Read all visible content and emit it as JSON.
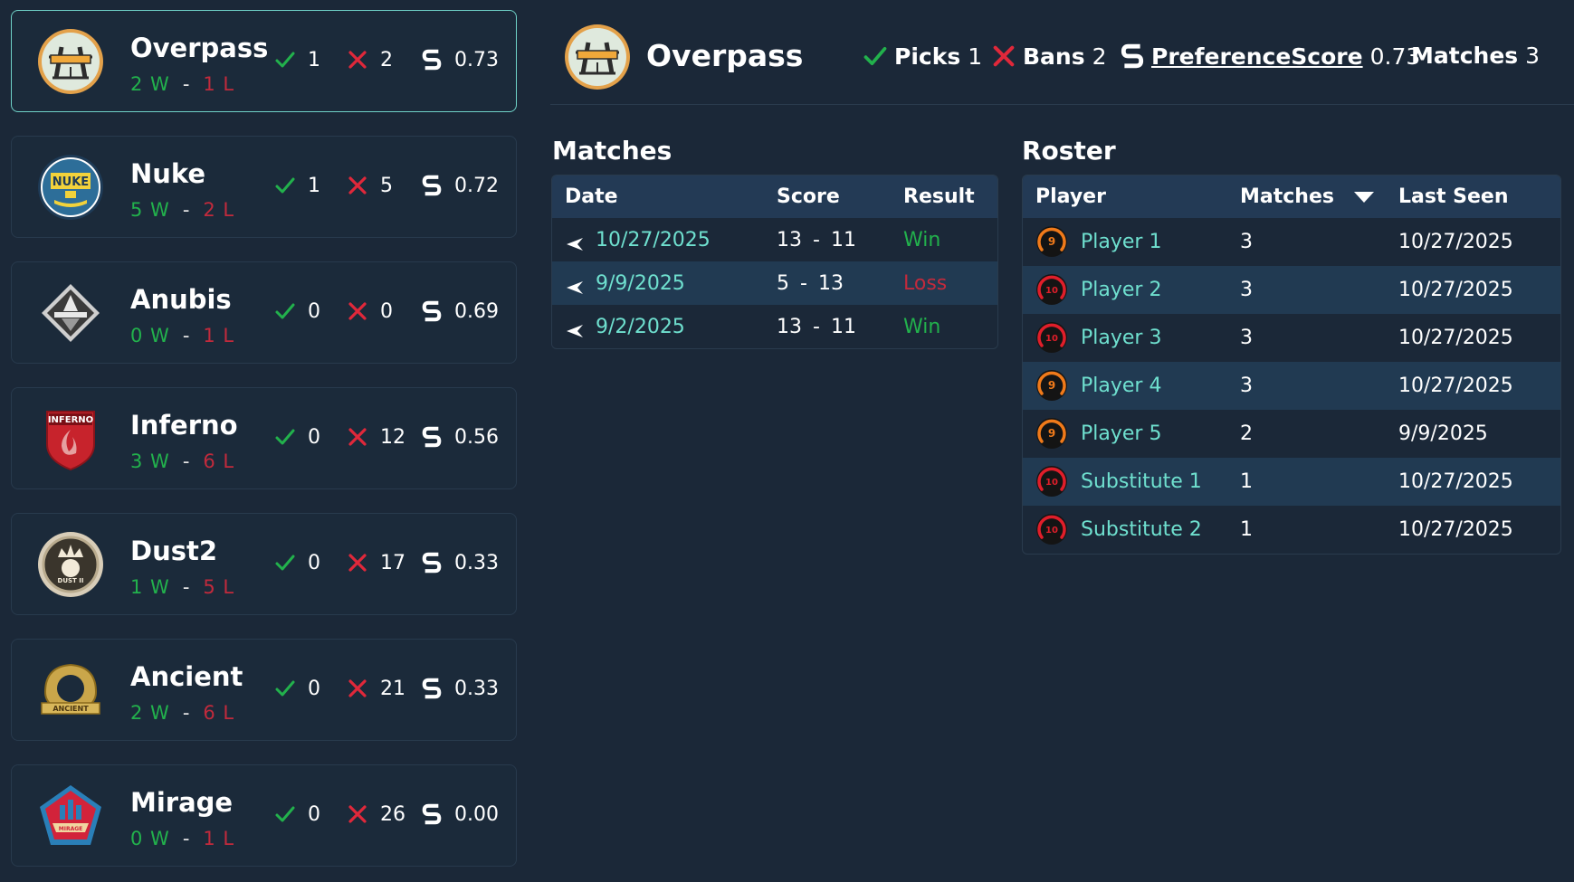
{
  "maps": [
    {
      "name": "Overpass",
      "wins": "2 W",
      "losses": "1 L",
      "picks": "1",
      "bans": "2",
      "score": "0.73",
      "icon": "overpass-emblem",
      "active": true
    },
    {
      "name": "Nuke",
      "wins": "5 W",
      "losses": "2 L",
      "picks": "1",
      "bans": "5",
      "score": "0.72",
      "icon": "nuke-emblem",
      "active": false
    },
    {
      "name": "Anubis",
      "wins": "0 W",
      "losses": "1 L",
      "picks": "0",
      "bans": "0",
      "score": "0.69",
      "icon": "anubis-emblem",
      "active": false
    },
    {
      "name": "Inferno",
      "wins": "3 W",
      "losses": "6 L",
      "picks": "0",
      "bans": "12",
      "score": "0.56",
      "icon": "inferno-emblem",
      "active": false
    },
    {
      "name": "Dust2",
      "wins": "1 W",
      "losses": "5 L",
      "picks": "0",
      "bans": "17",
      "score": "0.33",
      "icon": "dust2-emblem",
      "active": false
    },
    {
      "name": "Ancient",
      "wins": "2 W",
      "losses": "6 L",
      "picks": "0",
      "bans": "21",
      "score": "0.33",
      "icon": "ancient-emblem",
      "active": false
    },
    {
      "name": "Mirage",
      "wins": "0 W",
      "losses": "1 L",
      "picks": "0",
      "bans": "26",
      "score": "0.00",
      "icon": "mirage-emblem",
      "active": false
    }
  ],
  "detail": {
    "title": "Overpass",
    "picks_label": "Picks",
    "picks": "1",
    "bans_label": "Bans",
    "bans": "2",
    "pref_label": "PreferenceScore",
    "pref": "0.73",
    "matches_label": "Matches",
    "matches": "3"
  },
  "matches_section": {
    "title": "Matches",
    "headers": {
      "date": "Date",
      "score": "Score",
      "result": "Result"
    },
    "rows": [
      {
        "date": "10/27/2025",
        "score_a": "13",
        "score_b": "11",
        "result": "Win"
      },
      {
        "date": "9/9/2025",
        "score_a": "5",
        "score_b": "13",
        "result": "Loss"
      },
      {
        "date": "9/2/2025",
        "score_a": "13",
        "score_b": "11",
        "result": "Win"
      }
    ]
  },
  "roster_section": {
    "title": "Roster",
    "headers": {
      "player": "Player",
      "matches": "Matches",
      "last_seen": "Last Seen"
    },
    "rows": [
      {
        "name": "Player 1",
        "level": "9",
        "matches": "3",
        "last_seen": "10/27/2025"
      },
      {
        "name": "Player 2",
        "level": "10",
        "matches": "3",
        "last_seen": "10/27/2025"
      },
      {
        "name": "Player 3",
        "level": "10",
        "matches": "3",
        "last_seen": "10/27/2025"
      },
      {
        "name": "Player 4",
        "level": "9",
        "matches": "3",
        "last_seen": "10/27/2025"
      },
      {
        "name": "Player 5",
        "level": "9",
        "matches": "2",
        "last_seen": "9/9/2025"
      },
      {
        "name": "Substitute 1",
        "level": "10",
        "matches": "1",
        "last_seen": "10/27/2025"
      },
      {
        "name": "Substitute 2",
        "level": "10",
        "matches": "1",
        "last_seen": "10/27/2025"
      }
    ]
  },
  "colors": {
    "background": "#1b2838",
    "accent": "#6fe0cf",
    "win": "#22b14c",
    "loss": "#c22a3c",
    "level9": "#f07a1a",
    "level10": "#e01e2a"
  }
}
